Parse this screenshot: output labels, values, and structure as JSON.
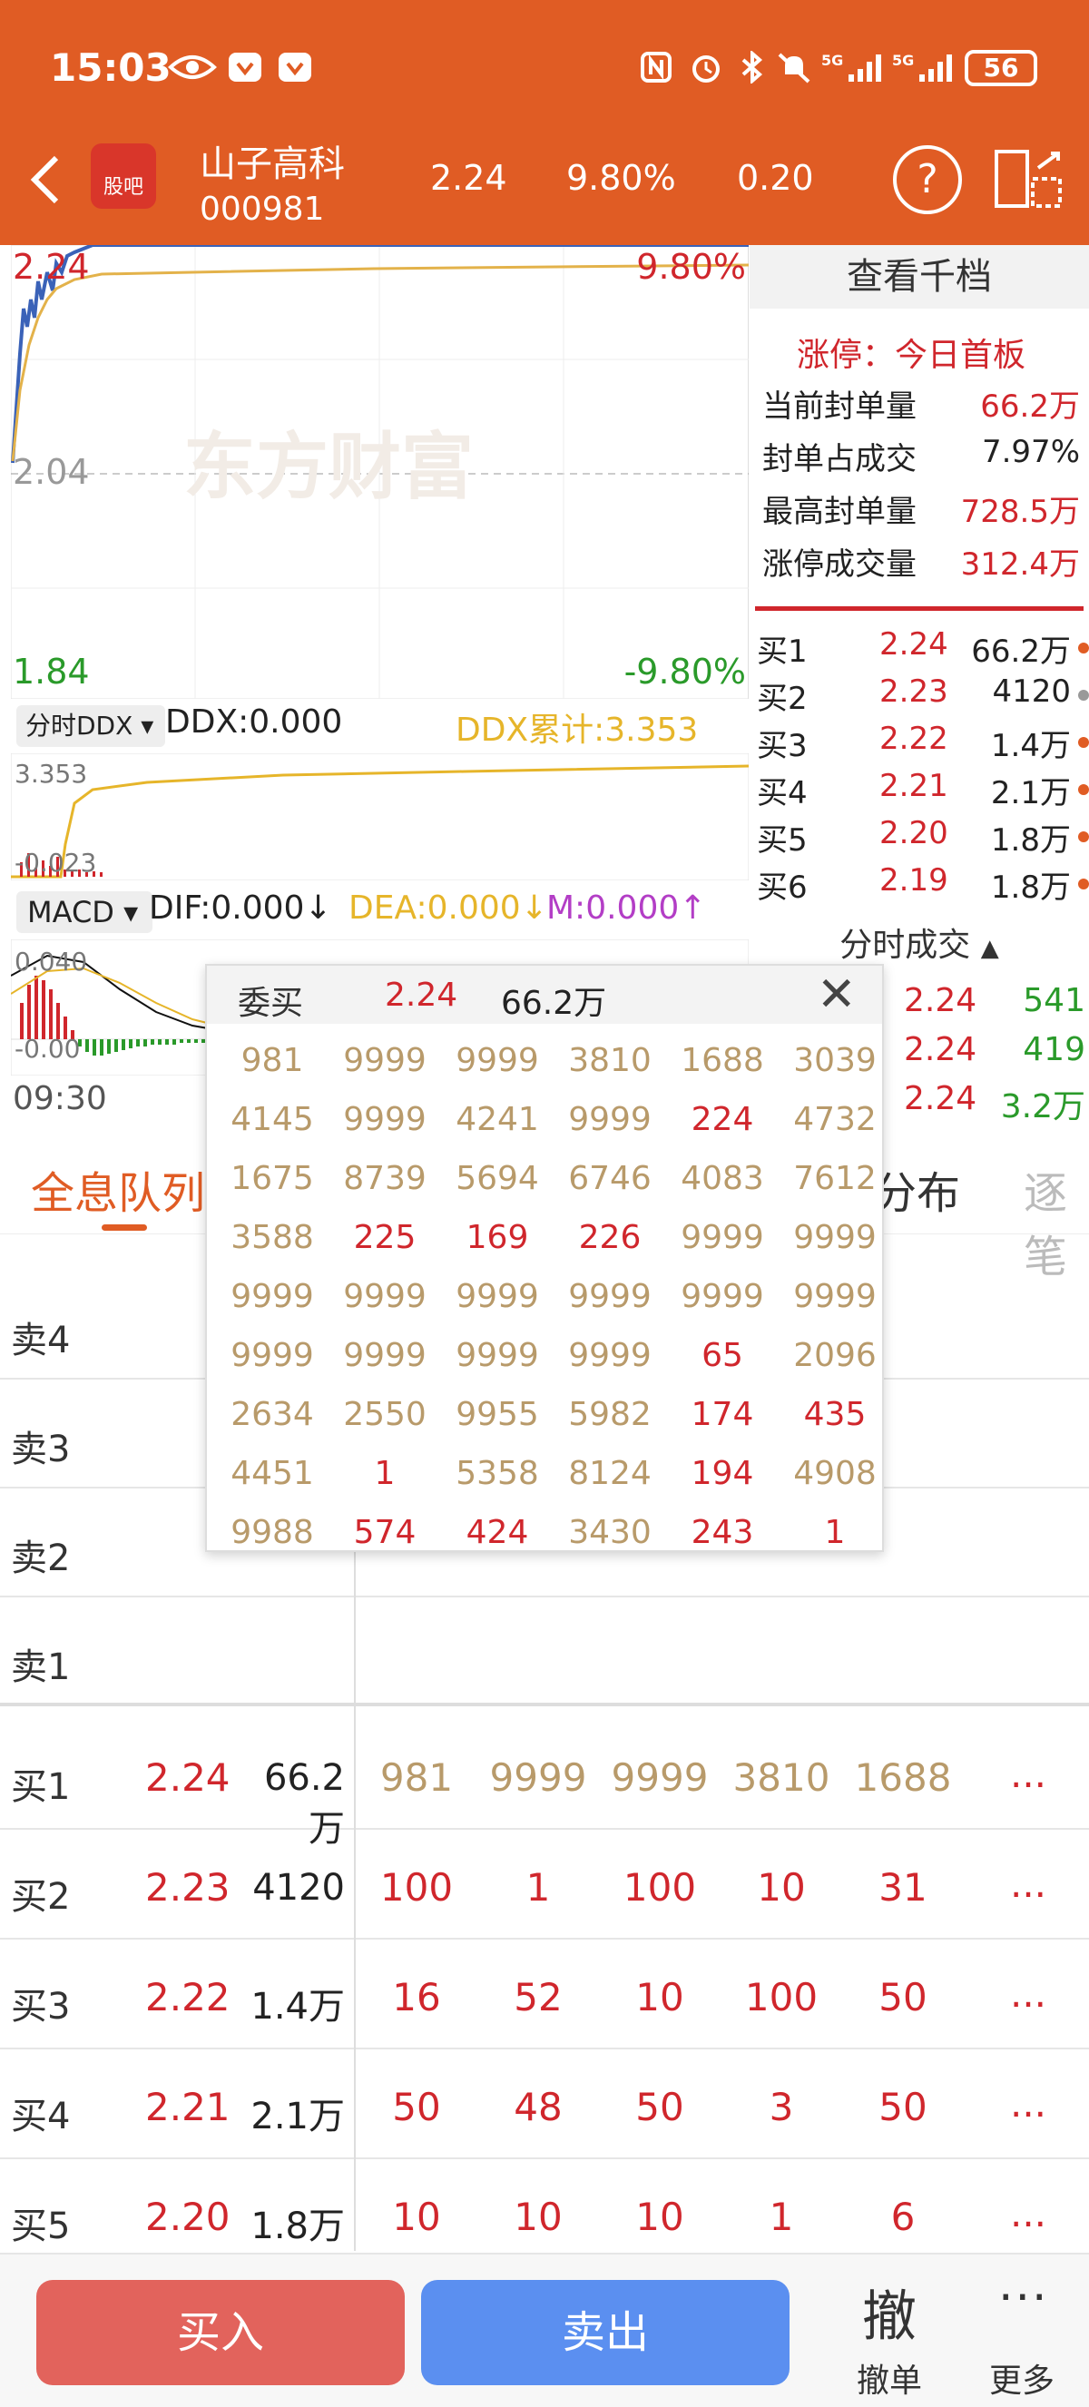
{
  "status_bar": {
    "time": "15:03",
    "battery": "56"
  },
  "header": {
    "badge": "股吧",
    "stock_name": "山子高科",
    "stock_code": "000981",
    "price": "2.24",
    "pct": "9.80%",
    "change": "0.20",
    "help": "?"
  },
  "price_chart": {
    "high": "2.24",
    "high_pct": "9.80%",
    "mid": "2.04",
    "low": "1.84",
    "low_pct": "-9.80%",
    "watermark": "东方财富",
    "time_start": "09:30"
  },
  "ddx": {
    "select": "分时DDX",
    "value": "DDX:0.000",
    "cumulative": "DDX累计:3.353",
    "y_top": "3.353",
    "y_bottom": "-0.023"
  },
  "macd": {
    "select": "MACD",
    "dif": "DIF:0.000↓",
    "dea": "DEA:0.000↓",
    "m": "M:0.000↑",
    "y_top": "0.040",
    "y_bottom": "-0.00"
  },
  "right_panel": {
    "title": "查看千档",
    "limit_status": "涨停：今日首板",
    "stats": [
      {
        "label": "当前封单量",
        "value": "66.2万"
      },
      {
        "label": "封单占成交",
        "value": "7.97%"
      },
      {
        "label": "最高封单量",
        "value": "728.5万"
      },
      {
        "label": "涨停成交量",
        "value": "312.4万"
      }
    ],
    "bids": [
      {
        "label": "买1",
        "price": "2.24",
        "vol": "66.2万"
      },
      {
        "label": "买2",
        "price": "2.23",
        "vol": "4120"
      },
      {
        "label": "买3",
        "price": "2.22",
        "vol": "1.4万"
      },
      {
        "label": "买4",
        "price": "2.21",
        "vol": "2.1万"
      },
      {
        "label": "买5",
        "price": "2.20",
        "vol": "1.8万"
      },
      {
        "label": "买6",
        "price": "2.19",
        "vol": "1.8万"
      }
    ],
    "trades_title": "分时成交",
    "trades": [
      {
        "price": "2.24",
        "vol": "541"
      },
      {
        "price": "2.24",
        "vol": "419"
      },
      {
        "price": "2.24",
        "vol": "3.2万"
      }
    ]
  },
  "tabs": {
    "t1": "全息队列",
    "t2": "分布",
    "t3": "逐笔"
  },
  "queue": {
    "sells": [
      "卖4",
      "卖3",
      "卖2",
      "卖1"
    ],
    "buys": [
      {
        "label": "买1",
        "price": "2.24",
        "vol": "66.2万",
        "cells": [
          "981",
          "9999",
          "9999",
          "3810",
          "1688"
        ],
        "more": "..."
      },
      {
        "label": "买2",
        "price": "2.23",
        "vol": "4120",
        "cells": [
          "100",
          "1",
          "100",
          "10",
          "31"
        ],
        "more": "..."
      },
      {
        "label": "买3",
        "price": "2.22",
        "vol": "1.4万",
        "cells": [
          "16",
          "52",
          "10",
          "100",
          "50"
        ],
        "more": "..."
      },
      {
        "label": "买4",
        "price": "2.21",
        "vol": "2.1万",
        "cells": [
          "50",
          "48",
          "50",
          "3",
          "50"
        ],
        "more": "..."
      },
      {
        "label": "买5",
        "price": "2.20",
        "vol": "1.8万",
        "cells": [
          "10",
          "10",
          "10",
          "1",
          "6"
        ],
        "more": "..."
      }
    ]
  },
  "popup": {
    "title": "委买",
    "price": "2.24",
    "vol": "66.2万",
    "close": "✕",
    "grid": [
      [
        "981",
        "9999",
        "9999",
        "3810",
        "1688",
        "3039"
      ],
      [
        "4145",
        "9999",
        "4241",
        "9999",
        "224",
        "4732"
      ],
      [
        "1675",
        "8739",
        "5694",
        "6746",
        "4083",
        "7612"
      ],
      [
        "3588",
        "225",
        "169",
        "226",
        "9999",
        "9999"
      ],
      [
        "9999",
        "9999",
        "9999",
        "9999",
        "9999",
        "9999"
      ],
      [
        "9999",
        "9999",
        "9999",
        "9999",
        "65",
        "2096"
      ],
      [
        "2634",
        "2550",
        "9955",
        "5982",
        "174",
        "435"
      ],
      [
        "4451",
        "1",
        "5358",
        "8124",
        "194",
        "4908"
      ],
      [
        "9988",
        "574",
        "424",
        "3430",
        "243",
        "1"
      ]
    ],
    "red_cells": [
      "224",
      "225",
      "169",
      "226",
      "65",
      "174",
      "435",
      "1",
      "194",
      "574",
      "424",
      "243"
    ]
  },
  "bottom_bar": {
    "buy": "买入",
    "sell": "卖出",
    "cancel_icon": "撤",
    "cancel": "撤单",
    "more_icon": "···",
    "more": "更多"
  },
  "colors": {
    "header": "#e05c24",
    "up": "#d0262c",
    "down": "#2a9a2a",
    "buy_btn": "#e2635c",
    "sell_btn": "#5b8ff0",
    "ddx": "#e6b52a",
    "macd_m": "#b33ec6"
  }
}
